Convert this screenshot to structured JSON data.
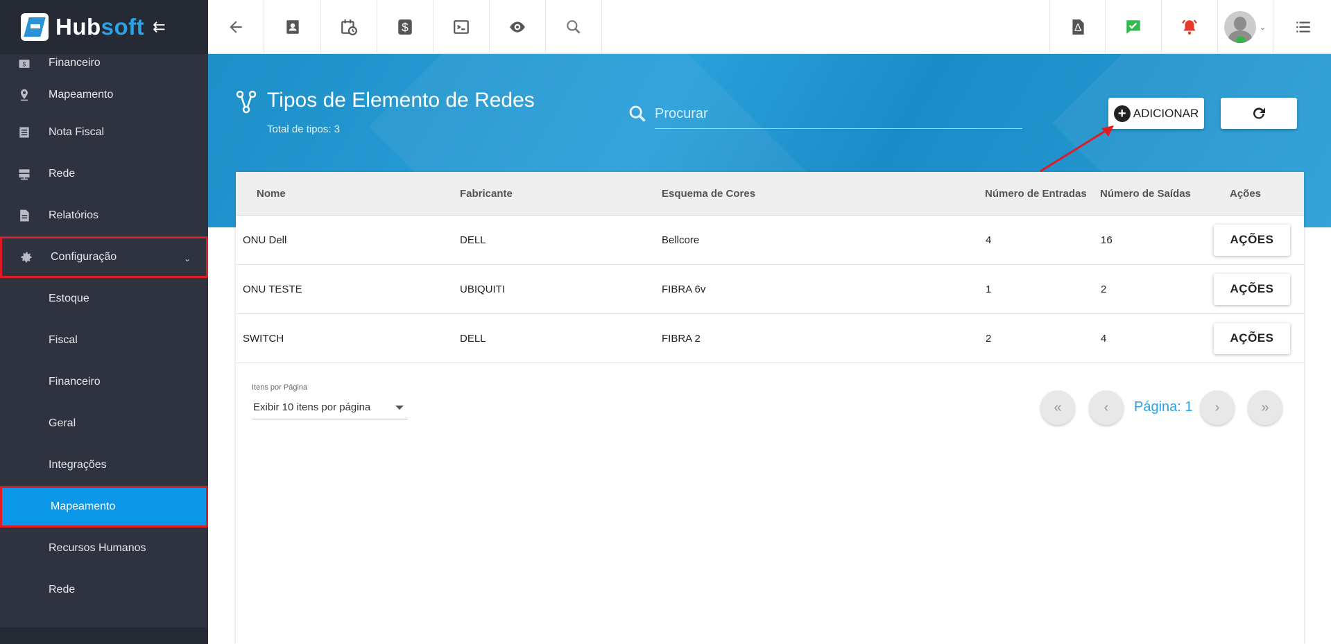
{
  "app": {
    "logo_hub": "Hub",
    "logo_soft": "soft"
  },
  "sidebar": {
    "items": [
      {
        "label": "Financeiro",
        "icon": "money-icon"
      },
      {
        "label": "Mapeamento",
        "icon": "map-pin-icon"
      },
      {
        "label": "Nota Fiscal",
        "icon": "document-icon"
      },
      {
        "label": "Rede",
        "icon": "server-icon"
      },
      {
        "label": "Relatórios",
        "icon": "report-icon"
      },
      {
        "label": "Configuração",
        "icon": "gear-icon"
      }
    ],
    "subitems": [
      {
        "label": "Estoque"
      },
      {
        "label": "Fiscal"
      },
      {
        "label": "Financeiro"
      },
      {
        "label": "Geral"
      },
      {
        "label": "Integrações"
      },
      {
        "label": "Mapeamento"
      },
      {
        "label": "Recursos Humanos"
      },
      {
        "label": "Rede"
      }
    ]
  },
  "page": {
    "title": "Tipos de Elemento de Redes",
    "subtitle": "Total de tipos: 3"
  },
  "search": {
    "placeholder": "Procurar"
  },
  "actions": {
    "add_label": "ADICIONAR"
  },
  "table": {
    "columns": [
      "Nome",
      "Fabricante",
      "Esquema de Cores",
      "Número de Entradas",
      "Número de Saídas",
      "Ações"
    ],
    "rows": [
      {
        "nome": "ONU Dell",
        "fabricante": "DELL",
        "esquema": "Bellcore",
        "entradas": "4",
        "saidas": "16",
        "acao": "AÇÕES"
      },
      {
        "nome": "ONU TESTE",
        "fabricante": "UBIQUITI",
        "esquema": "FIBRA 6v",
        "entradas": "1",
        "saidas": "2",
        "acao": "AÇÕES"
      },
      {
        "nome": "SWITCH",
        "fabricante": "DELL",
        "esquema": "FIBRA 2",
        "entradas": "2",
        "saidas": "4",
        "acao": "AÇÕES"
      }
    ]
  },
  "pagination": {
    "items_per_page_label": "Itens por Página",
    "items_per_page_value": "Exibir 10 itens por página",
    "page_label": "Página: 1"
  },
  "colors": {
    "sidebar_bg": "#2f3340",
    "accent": "#0d97e8",
    "highlight_border": "#e01b24",
    "hero_blue": "#1e8fc8"
  }
}
